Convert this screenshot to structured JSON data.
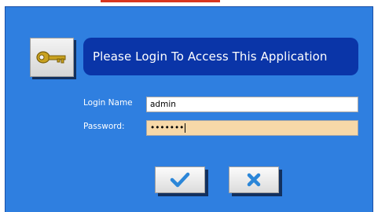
{
  "dialog": {
    "banner_text": "Please Login To Access This Application",
    "key_icon": "key-icon"
  },
  "form": {
    "login_label": "Login Name",
    "login_value": "admin",
    "password_label": "Password:",
    "password_mask": "•••••••"
  },
  "actions": {
    "ok_icon": "checkmark-icon",
    "cancel_icon": "close-icon"
  },
  "colors": {
    "dialog_background": "#2f7fe0",
    "banner_background": "#0a35a8",
    "password_field_background": "#f7d8a8",
    "check_color": "#2b86d8",
    "cancel_color": "#2b86d8",
    "top_accent": "#d8361f"
  }
}
